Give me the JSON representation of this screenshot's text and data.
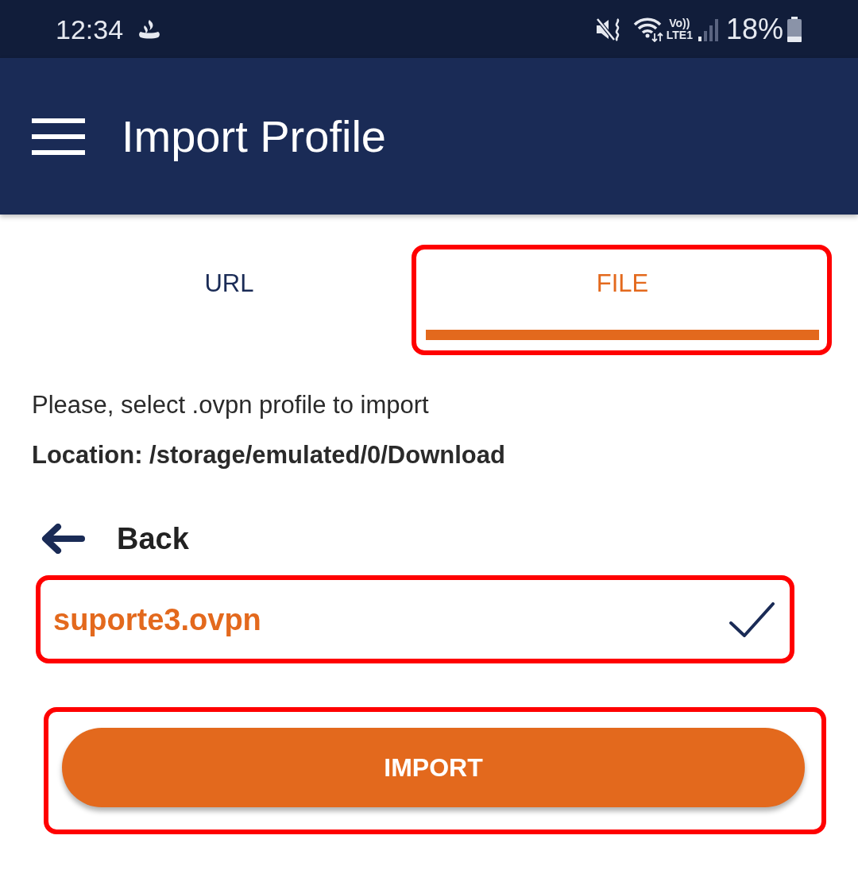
{
  "status_bar": {
    "time": "12:34",
    "volte": "Vo))",
    "network": "LTE1",
    "battery": "18%"
  },
  "app_bar": {
    "title": "Import Profile"
  },
  "tabs": [
    {
      "label": "URL",
      "selected": false,
      "highlighted": false
    },
    {
      "label": "FILE",
      "selected": true,
      "highlighted": true
    }
  ],
  "instructions": "Please, select .ovpn profile to import",
  "location": "Location: /storage/emulated/0/Download",
  "back_button": {
    "label": "Back"
  },
  "files": [
    {
      "name": "suporte3.ovpn",
      "selected": true,
      "highlighted": true
    }
  ],
  "import_button": {
    "label": "IMPORT",
    "highlighted": true
  }
}
